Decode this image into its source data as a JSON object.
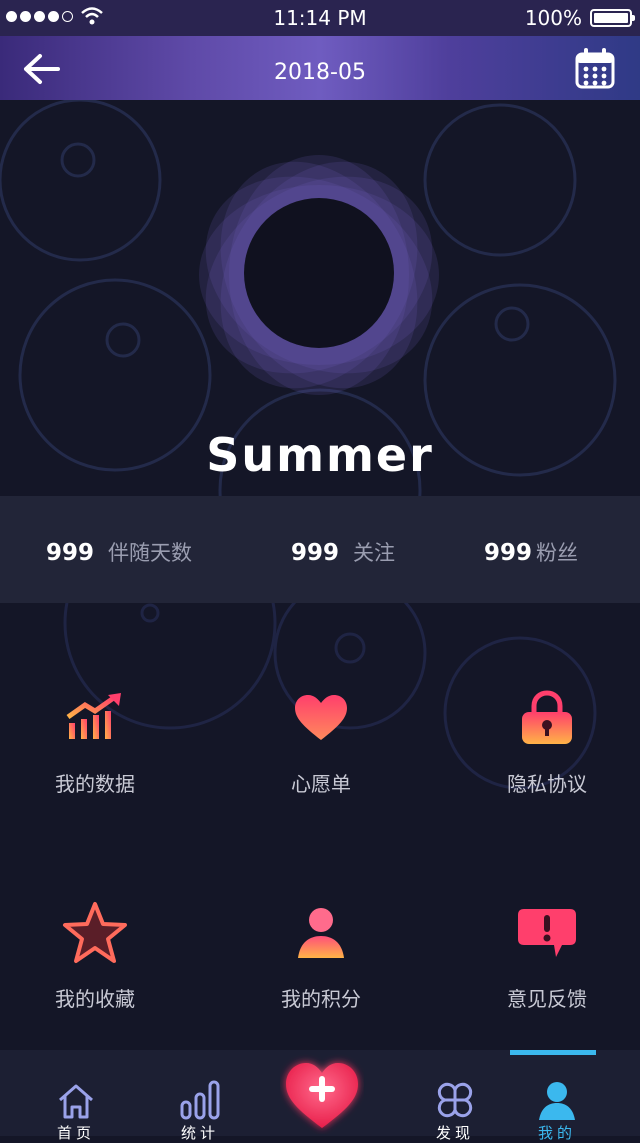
{
  "status_bar": {
    "time": "11:14 PM",
    "battery": "100%"
  },
  "header": {
    "title": "2018-05"
  },
  "profile": {
    "name": "Summer"
  },
  "stats": [
    {
      "value": "999",
      "label": "伴随天数"
    },
    {
      "value": "999",
      "label": "关注"
    },
    {
      "value": "999",
      "label": "粉丝"
    }
  ],
  "menu": [
    {
      "label": "我的数据",
      "icon": "chart-up-icon"
    },
    {
      "label": "心愿单",
      "icon": "heart-icon"
    },
    {
      "label": "隐私协议",
      "icon": "lock-icon"
    },
    {
      "label": "我的收藏",
      "icon": "star-icon"
    },
    {
      "label": "我的积分",
      "icon": "user-icon"
    },
    {
      "label": "意见反馈",
      "icon": "feedback-icon"
    }
  ],
  "tabs": [
    {
      "label": "首页",
      "icon": "home-icon"
    },
    {
      "label": "统计",
      "icon": "stats-icon"
    },
    {
      "label": "发现",
      "icon": "discover-icon"
    },
    {
      "label": "我的",
      "icon": "profile-icon",
      "active": true
    }
  ],
  "colors": {
    "accent": "#3bb8ee",
    "icon_gradient_start": "#ff3f6c",
    "icon_gradient_end": "#ffb347",
    "background": "#141627"
  }
}
